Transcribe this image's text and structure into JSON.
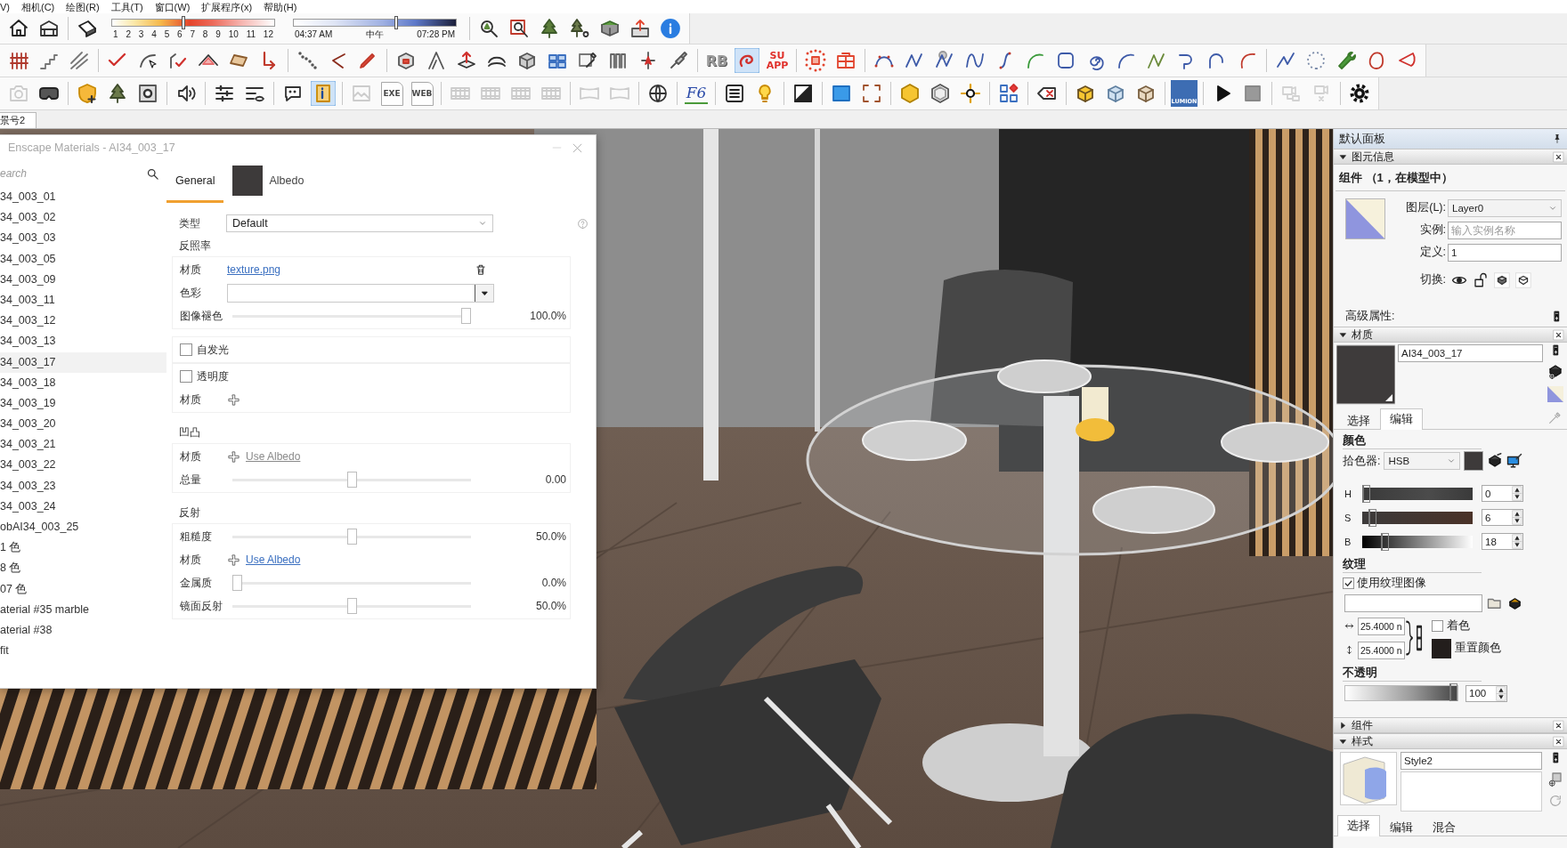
{
  "menu_bar": {
    "items": [
      "V)",
      "相机(C)",
      "绘图(R)",
      "工具(T)",
      "窗口(W)",
      "扩展程序(x)",
      "帮助(H)"
    ]
  },
  "toolbar_rows": [
    {
      "groups": [
        {
          "kind": "buttons",
          "buttons": [
            {
              "selected": false,
              "disabled": false
            },
            {
              "selected": false,
              "disabled": false
            }
          ]
        },
        {
          "kind": "buttons",
          "buttons": [
            {
              "selected": false,
              "disabled": false
            }
          ]
        },
        {
          "kind": "slider",
          "level": 0.44,
          "labels": [
            "1",
            "2",
            "3",
            "4",
            "5",
            "6",
            "7",
            "8",
            "9",
            "10",
            "11",
            "12"
          ]
        },
        {
          "kind": "time_slider",
          "level": 0.63,
          "labels": [
            "04:37 AM",
            "中午",
            "07:28 PM"
          ]
        },
        {
          "kind": "buttons",
          "buttons": [
            {
              "selected": false,
              "disabled": false
            },
            {
              "selected": false,
              "disabled": false
            },
            {
              "selected": false,
              "disabled": false
            },
            {
              "selected": false,
              "disabled": false
            },
            {
              "selected": false,
              "disabled": false
            },
            {
              "selected": false,
              "disabled": false
            },
            {
              "selected": false,
              "disabled": false
            }
          ]
        }
      ]
    },
    {
      "groups": [
        {
          "kind": "buttons",
          "buttons": [
            {
              "selected": false,
              "disabled": false
            },
            {
              "selected": false,
              "disabled": false
            },
            {
              "selected": false,
              "disabled": false
            }
          ]
        },
        {
          "kind": "buttons",
          "buttons": [
            {
              "selected": false,
              "disabled": false
            },
            {
              "selected": false,
              "disabled": false
            },
            {
              "selected": false,
              "disabled": false
            },
            {
              "selected": false,
              "disabled": false
            },
            {
              "selected": false,
              "disabled": false
            },
            {
              "selected": false,
              "disabled": false
            }
          ]
        },
        {
          "kind": "buttons",
          "buttons": [
            {
              "selected": false,
              "disabled": false
            },
            {
              "selected": false,
              "disabled": false
            },
            {
              "selected": false,
              "disabled": false
            }
          ]
        },
        {
          "kind": "buttons",
          "buttons": [
            {
              "selected": false,
              "disabled": false
            },
            {
              "selected": false,
              "disabled": false
            },
            {
              "selected": false,
              "disabled": false
            },
            {
              "selected": false,
              "disabled": false
            },
            {
              "selected": false,
              "disabled": false
            },
            {
              "selected": false,
              "disabled": false
            },
            {
              "selected": false,
              "disabled": false
            },
            {
              "selected": false,
              "disabled": false
            },
            {
              "selected": false,
              "disabled": false
            },
            {
              "selected": false,
              "disabled": false
            }
          ]
        },
        {
          "kind": "buttons",
          "buttons": [
            {
              "selected": false,
              "disabled": false,
              "label": "RB"
            },
            {
              "selected": true,
              "disabled": false
            },
            {
              "selected": false,
              "disabled": false,
              "label": "SU APP"
            }
          ]
        },
        {
          "kind": "buttons",
          "buttons": [
            {
              "selected": false,
              "disabled": false
            },
            {
              "selected": false,
              "disabled": false
            }
          ]
        },
        {
          "kind": "buttons",
          "buttons": [
            {
              "selected": false,
              "disabled": false
            },
            {
              "selected": false,
              "disabled": false
            },
            {
              "selected": false,
              "disabled": false
            },
            {
              "selected": false,
              "disabled": false
            },
            {
              "selected": false,
              "disabled": false
            },
            {
              "selected": false,
              "disabled": false
            },
            {
              "selected": false,
              "disabled": false
            },
            {
              "selected": false,
              "disabled": false
            },
            {
              "selected": false,
              "disabled": false
            },
            {
              "selected": false,
              "disabled": false
            },
            {
              "selected": false,
              "disabled": false
            },
            {
              "selected": false,
              "disabled": false
            },
            {
              "selected": false,
              "disabled": false
            }
          ]
        },
        {
          "kind": "buttons",
          "buttons": [
            {
              "selected": false,
              "disabled": false
            },
            {
              "selected": false,
              "disabled": false
            },
            {
              "selected": false,
              "disabled": false
            },
            {
              "selected": false,
              "disabled": false
            },
            {
              "selected": false,
              "disabled": false
            }
          ]
        }
      ]
    },
    {
      "groups": [
        {
          "kind": "buttons",
          "buttons": [
            {
              "selected": false,
              "disabled": true
            },
            {
              "selected": false,
              "disabled": false
            }
          ]
        },
        {
          "kind": "buttons",
          "buttons": [
            {
              "selected": false,
              "disabled": false
            },
            {
              "selected": false,
              "disabled": false
            },
            {
              "selected": false,
              "disabled": false
            }
          ]
        },
        {
          "kind": "buttons",
          "buttons": [
            {
              "selected": false,
              "disabled": false
            }
          ]
        },
        {
          "kind": "buttons",
          "buttons": [
            {
              "selected": false,
              "disabled": false
            },
            {
              "selected": false,
              "disabled": false
            }
          ]
        },
        {
          "kind": "buttons",
          "buttons": [
            {
              "selected": false,
              "disabled": false
            },
            {
              "selected": true,
              "disabled": false
            }
          ]
        },
        {
          "kind": "buttons",
          "buttons": [
            {
              "selected": false,
              "disabled": true
            },
            {
              "selected": false,
              "disabled": true,
              "label": "EXE"
            },
            {
              "selected": false,
              "disabled": true,
              "label": "WEB"
            }
          ]
        },
        {
          "kind": "buttons",
          "buttons": [
            {
              "selected": false,
              "disabled": true
            },
            {
              "selected": false,
              "disabled": true
            },
            {
              "selected": false,
              "disabled": true
            },
            {
              "selected": false,
              "disabled": true
            }
          ]
        },
        {
          "kind": "buttons",
          "buttons": [
            {
              "selected": false,
              "disabled": true
            },
            {
              "selected": false,
              "disabled": true
            }
          ]
        },
        {
          "kind": "buttons",
          "buttons": [
            {
              "selected": false,
              "disabled": false
            }
          ]
        },
        {
          "kind": "buttons",
          "buttons": [
            {
              "selected": false,
              "disabled": false,
              "label": "F6"
            }
          ]
        },
        {
          "kind": "buttons",
          "buttons": [
            {
              "selected": false,
              "disabled": false
            },
            {
              "selected": false,
              "disabled": false
            }
          ]
        },
        {
          "kind": "buttons",
          "buttons": [
            {
              "selected": false,
              "disabled": false
            }
          ]
        },
        {
          "kind": "buttons",
          "buttons": [
            {
              "selected": false,
              "disabled": false
            },
            {
              "selected": false,
              "disabled": false
            }
          ]
        },
        {
          "kind": "buttons",
          "buttons": [
            {
              "selected": false,
              "disabled": false
            },
            {
              "selected": false,
              "disabled": false
            },
            {
              "selected": false,
              "disabled": false
            }
          ]
        },
        {
          "kind": "buttons",
          "buttons": [
            {
              "selected": false,
              "disabled": false
            }
          ]
        },
        {
          "kind": "buttons",
          "buttons": [
            {
              "selected": false,
              "disabled": false
            }
          ]
        },
        {
          "kind": "buttons",
          "buttons": [
            {
              "selected": false,
              "disabled": false
            },
            {
              "selected": false,
              "disabled": false
            },
            {
              "selected": false,
              "disabled": false
            }
          ]
        },
        {
          "kind": "buttons",
          "buttons": [
            {
              "selected": false,
              "disabled": false,
              "label": "LUMION"
            }
          ]
        },
        {
          "kind": "buttons",
          "buttons": [
            {
              "selected": false,
              "disabled": false
            },
            {
              "selected": false,
              "disabled": false
            }
          ]
        },
        {
          "kind": "buttons",
          "buttons": [
            {
              "selected": false,
              "disabled": true
            },
            {
              "selected": false,
              "disabled": true
            }
          ]
        },
        {
          "kind": "buttons",
          "buttons": [
            {
              "selected": false,
              "disabled": false
            }
          ]
        }
      ]
    }
  ],
  "scene_tabs": [
    {
      "label": "景号2",
      "selected": true
    }
  ],
  "materials_window": {
    "title": "Enscape Materials - AI34_003_17",
    "search": {
      "placeholder": "earch"
    },
    "materials": [
      {
        "name": "34_003_01",
        "selected": false
      },
      {
        "name": "34_003_02",
        "selected": false
      },
      {
        "name": "34_003_03",
        "selected": false
      },
      {
        "name": "34_003_05",
        "selected": false
      },
      {
        "name": "34_003_09",
        "selected": false
      },
      {
        "name": "34_003_11",
        "selected": false
      },
      {
        "name": "34_003_12",
        "selected": false
      },
      {
        "name": "34_003_13",
        "selected": false
      },
      {
        "name": "34_003_17",
        "selected": true
      },
      {
        "name": "34_003_18",
        "selected": false
      },
      {
        "name": "34_003_19",
        "selected": false
      },
      {
        "name": "34_003_20",
        "selected": false
      },
      {
        "name": "34_003_21",
        "selected": false
      },
      {
        "name": "34_003_22",
        "selected": false
      },
      {
        "name": "34_003_23",
        "selected": false
      },
      {
        "name": "34_003_24",
        "selected": false
      },
      {
        "name": "obAI34_003_25",
        "selected": false
      },
      {
        "name": "1 色",
        "selected": false
      },
      {
        "name": "8 色",
        "selected": false
      },
      {
        "name": "07 色",
        "selected": false
      },
      {
        "name": "aterial #35 marble",
        "selected": false
      },
      {
        "name": "aterial #38",
        "selected": false
      },
      {
        "name": "fit",
        "selected": false
      }
    ],
    "tabs": [
      {
        "kind": "text",
        "label": "General",
        "selected": true
      },
      {
        "kind": "swatch",
        "label": "Albedo",
        "selected": false
      }
    ],
    "type_row": {
      "label": "类型",
      "value": "Default"
    },
    "sections": [
      {
        "title": "反照率",
        "rows": [
          {
            "kind": "texture",
            "label": "材质",
            "link": "texture.png"
          },
          {
            "kind": "color",
            "label": "色彩"
          },
          {
            "kind": "slider",
            "label": "图像褪色",
            "level": 1,
            "reading": "100.0%"
          }
        ]
      },
      {
        "rows": [
          {
            "kind": "checkbox",
            "label": "自发光",
            "checked": false
          }
        ]
      },
      {
        "rows": [
          {
            "kind": "checkbox",
            "label": "透明度",
            "checked": false
          },
          {
            "kind": "add",
            "label": "材质"
          }
        ]
      },
      {
        "title": "凹凸",
        "rows": [
          {
            "kind": "add",
            "label": "材质",
            "link": "Use Albedo",
            "disabled": true
          },
          {
            "kind": "slider",
            "label": "总量",
            "level": 0.5,
            "reading": "0.00"
          }
        ]
      },
      {
        "title": "反射",
        "rows": [
          {
            "kind": "slider",
            "label": "粗糙度",
            "level": 0.5,
            "reading": "50.0%"
          },
          {
            "kind": "add",
            "label": "材质",
            "link": "Use Albedo",
            "disabled": false
          },
          {
            "kind": "slider",
            "label": "金属质",
            "level": 0,
            "reading": "0.0%"
          },
          {
            "kind": "slider",
            "label": "镜面反射",
            "level": 0.5,
            "reading": "50.0%"
          }
        ]
      }
    ]
  },
  "tray": {
    "title": "默认面板",
    "entity_info": {
      "title": "图元信息",
      "expanded": true,
      "heading": "组件 （1，在模型中）",
      "fields": [
        {
          "kind": "dropdown",
          "label": "图层(L):",
          "value": "Layer0"
        },
        {
          "kind": "input",
          "label": "实例:",
          "placeholder": "输入实例名称"
        },
        {
          "kind": "input",
          "label": "定义:",
          "value": "1"
        }
      ],
      "toggle_label": "切换:",
      "advanced_label": "高级属性:"
    },
    "materials": {
      "title": "材质",
      "expanded": true,
      "name": "AI34_003_17",
      "tabs": [
        {
          "label": "选择",
          "selected": false
        },
        {
          "label": "编辑",
          "selected": true
        }
      ],
      "color_title": "颜色",
      "picker_label": "拾色器:",
      "picker": "HSB",
      "channels": [
        {
          "name": "H",
          "level": 0,
          "value": "0"
        },
        {
          "name": "S",
          "level": 0.06,
          "value": "6"
        },
        {
          "name": "B",
          "level": 0.18,
          "value": "18"
        }
      ],
      "texture_title": "纹理",
      "use_texture": {
        "label": "使用纹理图像",
        "checked": true
      },
      "sizes": [
        "25.4000 n",
        "25.4000 n"
      ],
      "colorize": {
        "label": "着色",
        "checked": false
      },
      "reset_label": "重置颜色",
      "opacity_title": "不透明",
      "opacity": {
        "level": 1,
        "value": "100"
      }
    },
    "components": {
      "title": "组件",
      "expanded": false
    },
    "styles": {
      "title": "样式",
      "expanded": true,
      "name": "Style2",
      "tabs": [
        {
          "label": "选择",
          "selected": true
        },
        {
          "label": "编辑",
          "selected": false
        },
        {
          "label": "混合",
          "selected": false
        }
      ]
    }
  }
}
